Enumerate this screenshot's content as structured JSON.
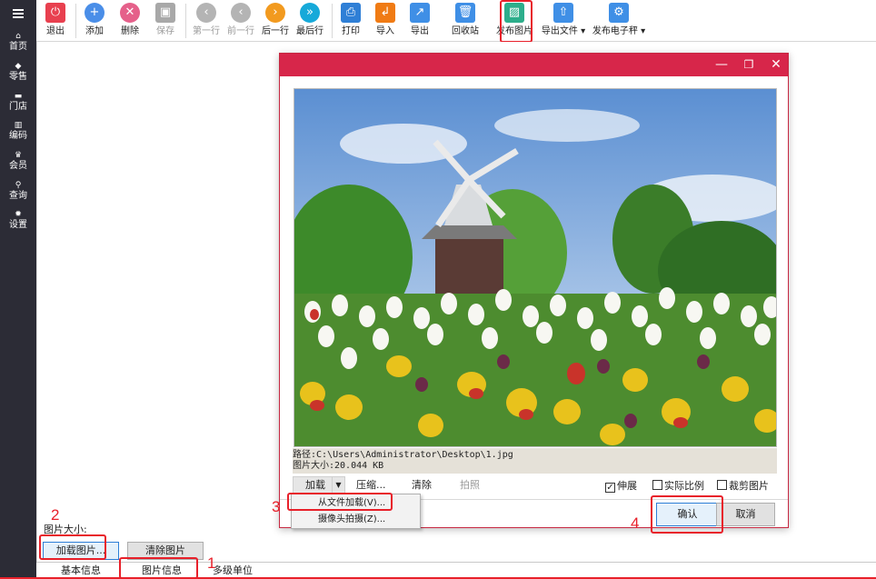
{
  "left_nav": {
    "items": [
      {
        "icon": "home-icon",
        "glyph": "⌂",
        "label": "首页"
      },
      {
        "icon": "tag-icon",
        "glyph": "◆",
        "label": "零售"
      },
      {
        "icon": "store-icon",
        "glyph": "▬",
        "label": "门店"
      },
      {
        "icon": "barcode-icon",
        "glyph": "▥",
        "label": "编码"
      },
      {
        "icon": "crown-icon",
        "glyph": "♛",
        "label": "会员"
      },
      {
        "icon": "search-icon",
        "glyph": "⚲",
        "label": "查询"
      },
      {
        "icon": "gear-icon",
        "glyph": "✹",
        "label": "设置"
      }
    ]
  },
  "toolbar": {
    "buttons": [
      {
        "label": "退出",
        "icon": "power-icon",
        "glyph": "⏻",
        "color": "#e8404f",
        "enabled": true
      },
      {
        "label": "添加",
        "icon": "add-icon",
        "glyph": "+",
        "color": "#4a8ee8",
        "enabled": true
      },
      {
        "label": "删除",
        "icon": "delete-icon",
        "glyph": "✕",
        "color": "#e5608a",
        "enabled": true
      },
      {
        "label": "保存",
        "icon": "save-icon",
        "glyph": "▣",
        "color": "#a8a8a8",
        "enabled": false
      },
      {
        "label": "第一行",
        "icon": "first-row-icon",
        "glyph": "‹",
        "color": "#b4b4b4",
        "enabled": false
      },
      {
        "label": "前一行",
        "icon": "prev-row-icon",
        "glyph": "‹",
        "color": "#b4b4b4",
        "enabled": false
      },
      {
        "label": "后一行",
        "icon": "next-row-icon",
        "glyph": "›",
        "color": "#f29a1f",
        "enabled": true
      },
      {
        "label": "最后行",
        "icon": "last-row-icon",
        "glyph": "»",
        "color": "#16a9d9",
        "enabled": true
      },
      {
        "label": "打印",
        "icon": "print-icon",
        "glyph": "⎙",
        "color": "#2f7fd6",
        "enabled": true
      },
      {
        "label": "导入",
        "icon": "import-icon",
        "glyph": "↲",
        "color": "#f07b14",
        "enabled": true
      },
      {
        "label": "导出",
        "icon": "export-icon",
        "glyph": "↗",
        "color": "#3f8fe6",
        "enabled": true
      },
      {
        "label": "回收站",
        "icon": "trash-icon",
        "glyph": "🗑",
        "color": "#3f8fe6",
        "enabled": true
      },
      {
        "label": "发布图片",
        "icon": "publish-image-icon",
        "glyph": "▨",
        "color": "#2dae8b",
        "enabled": true
      },
      {
        "label": "导出文件 ▾",
        "icon": "export-file-icon",
        "glyph": "⇧",
        "color": "#3f8fe6",
        "enabled": true
      },
      {
        "label": "发布电子秤 ▾",
        "icon": "scale-gear-icon",
        "glyph": "⚙",
        "color": "#3f8fe6",
        "enabled": true
      }
    ]
  },
  "form": {
    "image_size_label": "图片大小:",
    "load_image_button": "加载图片...",
    "clear_image_button": "清除图片"
  },
  "tabs": [
    "基本信息",
    "图片信息",
    "多级单位"
  ],
  "dialog": {
    "window_controls": [
      "—",
      "❐",
      "✕"
    ],
    "path_line": "路径:C:\\Users\\Administrator\\Desktop\\1.jpg",
    "size_line": "图片大小:20.044 KB",
    "load_label": "加载",
    "compress_label": "压缩...",
    "clear_label": "清除",
    "capture_label": "拍照",
    "stretch_label": "伸展",
    "stretch_checked": true,
    "actual_ratio_label": "实际比例",
    "actual_ratio_checked": false,
    "crop_label": "裁剪图片",
    "crop_checked": false,
    "confirm_button": "确认",
    "cancel_button": "取消"
  },
  "dropdown": {
    "items": [
      "从文件加载(V)...",
      "摄像头拍摄(Z)..."
    ]
  },
  "annotations": [
    "1",
    "2",
    "3",
    "4"
  ],
  "colors": {
    "nav_bg": "#2c2c36",
    "dialog_title": "#d7264a",
    "highlight": "#e8202a"
  }
}
